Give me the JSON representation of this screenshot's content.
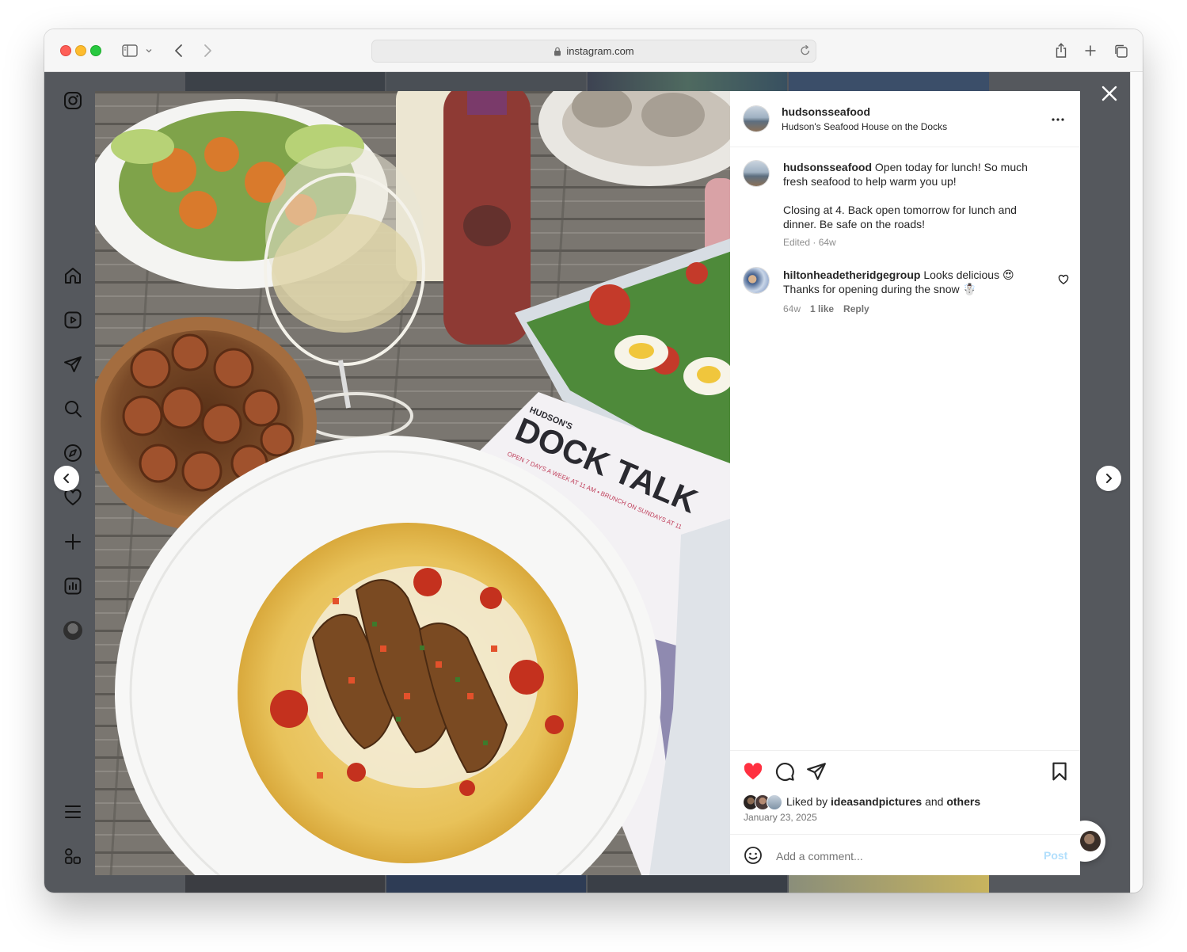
{
  "browser": {
    "url": "instagram.com"
  },
  "post": {
    "username": "hudsonsseafood",
    "location": "Hudson's Seafood House on the Docks",
    "caption_line1": "Open today for lunch! So much",
    "caption_line2": "fresh seafood to help warm you up!",
    "caption_line3": "Closing at 4. Back open tomorrow for lunch and",
    "caption_line4": "dinner. Be safe on the roads!",
    "caption_meta": "Edited · 64w",
    "photo_text": {
      "brand": "HUDSON'S",
      "magazine_title": "DOCK TALK",
      "magazine_sub": "OPEN 7 DAYS A WEEK AT 11 AM • BRUNCH ON SUNDAYS AT 11"
    },
    "comments": [
      {
        "username": "hiltonheadetheridgegroup",
        "text_line1": "Looks delicious 😍",
        "text_line2": "Thanks for opening during the snow ☃️",
        "age": "64w",
        "likes": "1 like",
        "reply": "Reply"
      }
    ],
    "liked_by_prefix": "Liked by",
    "liked_by_user": "ideasandpictures",
    "liked_by_and": "and",
    "liked_by_others": "others",
    "date": "January 23, 2025",
    "comment_placeholder": "Add a comment...",
    "post_button": "Post",
    "liked": true
  },
  "colors": {
    "like_red": "#ff3040",
    "post_blue_disabled": "#b2dffc",
    "overlay": "#55585d"
  },
  "icons": {
    "sidebar": [
      "instagram-logo-icon",
      "home-icon",
      "reels-icon",
      "messages-icon",
      "search-icon",
      "explore-icon",
      "notifications-icon",
      "create-icon",
      "insights-icon",
      "profile-avatar",
      "more-menu-icon",
      "meta-apps-icon"
    ]
  }
}
